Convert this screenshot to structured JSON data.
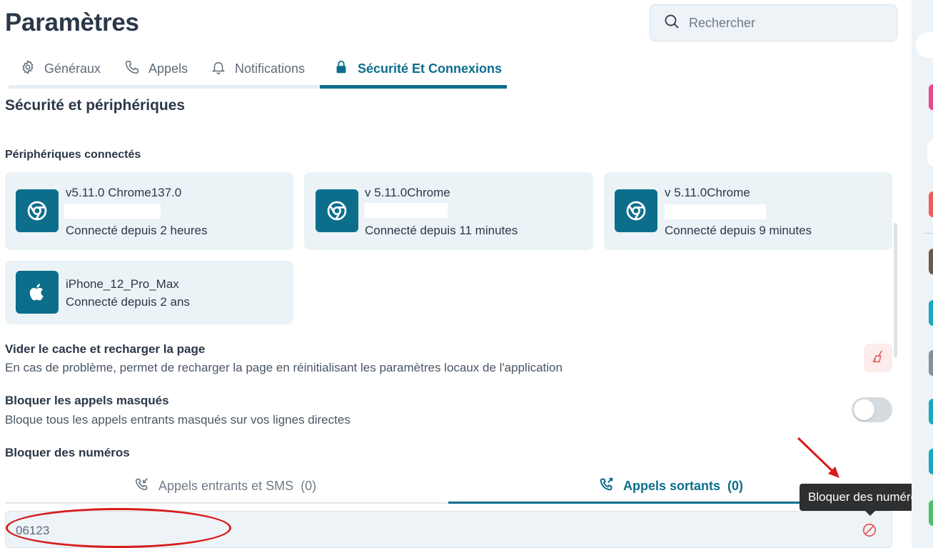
{
  "page": {
    "title": "Paramètres"
  },
  "search": {
    "placeholder": "Rechercher"
  },
  "tabs": [
    {
      "label": "Généraux",
      "icon": "gear-icon"
    },
    {
      "label": "Appels",
      "icon": "phone-icon"
    },
    {
      "label": "Notifications",
      "icon": "bell-icon"
    },
    {
      "label": "Sécurité Et Connexions",
      "icon": "lock-icon",
      "active": true
    }
  ],
  "section": {
    "title": "Sécurité et périphériques",
    "devices_title": "Périphériques connectés"
  },
  "devices": [
    {
      "name": "v5.11.0 Chrome137.0",
      "since": "Connecté depuis 2 heures",
      "icon": "chrome-icon"
    },
    {
      "name": "v 5.11.0Chrome",
      "since": "Connecté depuis 11 minutes",
      "icon": "chrome-icon"
    },
    {
      "name": "v 5.11.0Chrome",
      "since": "Connecté depuis 9 minutes",
      "icon": "chrome-icon"
    },
    {
      "name": "iPhone_12_Pro_Max",
      "since": "Connecté depuis 2 ans",
      "icon": "apple-icon"
    }
  ],
  "cache": {
    "title": "Vider le cache et recharger la page",
    "description": "En cas de problème, permet de recharger la page en réinitialisant les paramètres locaux de l'application"
  },
  "masked_calls": {
    "title": "Bloquer les appels masqués",
    "description": "Bloque tous les appels entrants masqués sur vos lignes directes",
    "enabled": false
  },
  "block_numbers": {
    "title": "Bloquer des numéros",
    "tabs": [
      {
        "label": "Appels entrants et SMS",
        "count": "(0)",
        "icon": "incoming-call-icon"
      },
      {
        "label": "Appels sortants",
        "count": "(0)",
        "icon": "outgoing-call-icon",
        "active": true
      }
    ],
    "input_value": "06123",
    "tooltip": "Bloquer des numéros"
  },
  "colors": {
    "accent": "#0d6e8c",
    "card_bg": "#ebf3f6",
    "danger": "#e05555",
    "annotation": "#d81b1b"
  }
}
